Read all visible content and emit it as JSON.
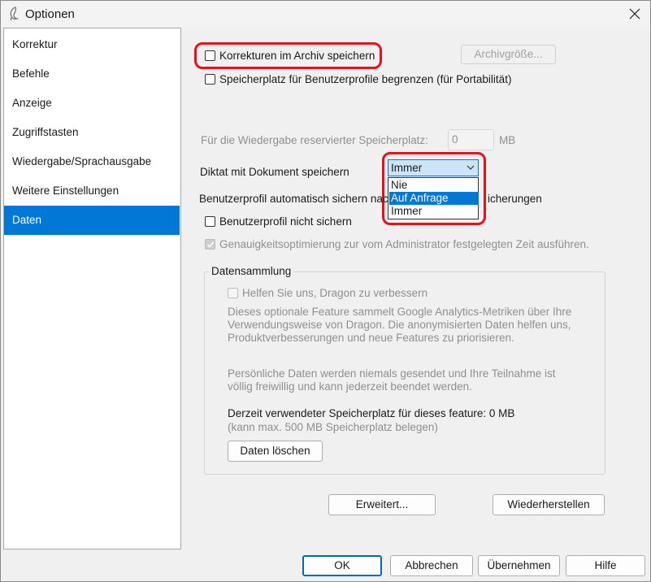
{
  "window": {
    "title": "Optionen"
  },
  "sidebar": {
    "items": [
      {
        "label": "Korrektur"
      },
      {
        "label": "Befehle"
      },
      {
        "label": "Anzeige"
      },
      {
        "label": "Zugriffstasten"
      },
      {
        "label": "Wiedergabe/Sprachausgabe"
      },
      {
        "label": "Weitere Einstellungen"
      },
      {
        "label": "Daten"
      }
    ],
    "selected": "Daten"
  },
  "main": {
    "archive_checkbox": {
      "label": "Korrekturen im Archiv speichern",
      "checked": false
    },
    "archive_size_button": "Archivgröße...",
    "limit_profile_checkbox": {
      "label": "Speicherplatz für Benutzerprofile begrenzen (für Portabilität)",
      "checked": false
    },
    "reserved_space": {
      "label": "Für die Wiedergabe reservierter Speicherplatz:",
      "value": "0",
      "unit": "MB"
    },
    "dictation_save": {
      "label": "Diktat mit Dokument speichern",
      "selected": "Immer",
      "options": [
        "Nie",
        "Auf Anfrage",
        "Immer"
      ],
      "highlighted": "Auf Anfrage"
    },
    "auto_backup": {
      "label_left": "Benutzerprofil automatisch sichern nac",
      "label_right": "icherungen"
    },
    "no_backup_checkbox": {
      "label": "Benutzerprofil nicht sichern",
      "checked": false
    },
    "accuracy_checkbox": {
      "label": "Genauigkeitsoptimierung zur vom Administrator festgelegten Zeit ausführen.",
      "checked": true
    },
    "data_collection": {
      "title": "Datensammlung",
      "help_checkbox": {
        "label": "Helfen Sie uns, Dragon zu verbessern",
        "checked": false
      },
      "description_lines": [
        "Dieses optionale Feature sammelt Google Analytics-Metriken über Ihre",
        "Verwendungsweise von Dragon. Die anonymisierten Daten helfen uns,",
        "Produktverbesserungen und neue Features zu priorisieren."
      ],
      "privacy_lines": [
        "Persönliche Daten werden niemals gesendet und Ihre Teilnahme ist",
        "völlig freiwillig und kann jederzeit beendet werden."
      ],
      "usage_text": "Derzeit verwendeter Speicherplatz für dieses feature: 0 MB",
      "usage_limit": "(kann max. 500 MB Speicherplatz belegen)",
      "delete_button": "Daten löschen"
    },
    "advanced_button": "Erweitert...",
    "restore_button": "Wiederherstellen"
  },
  "footer": {
    "ok": "OK",
    "cancel": "Abbrechen",
    "apply": "Übernehmen",
    "help": "Hilfe"
  },
  "colors": {
    "accent": "#0078d7",
    "highlight_box": "#e8101e"
  }
}
